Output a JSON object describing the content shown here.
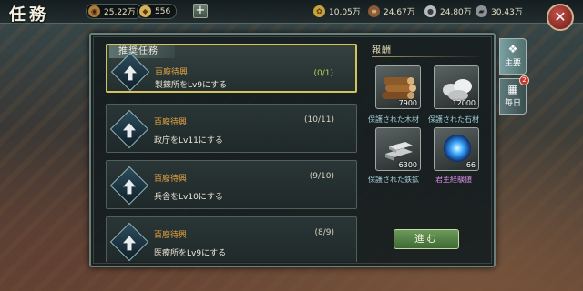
{
  "header": {
    "title": "任務",
    "resources_left": [
      {
        "icon": "copper-coin-icon",
        "value": "25.22万"
      },
      {
        "icon": "gold-ingot-icon",
        "value": "556"
      }
    ],
    "resources_right": [
      {
        "icon": "grain-icon",
        "value": "10.05万"
      },
      {
        "icon": "wood-icon",
        "value": "24.67万"
      },
      {
        "icon": "stone-icon",
        "value": "24.80万"
      },
      {
        "icon": "iron-icon",
        "value": "30.43万"
      }
    ]
  },
  "recommend_label": "推奨任務",
  "tasks": [
    {
      "name": "百廢待興",
      "desc": "製錬所をLv9にする",
      "progress": "(0/1)",
      "selected": true
    },
    {
      "name": "百廢待興",
      "desc": "政庁をLv11にする",
      "progress": "(10/11)",
      "selected": false
    },
    {
      "name": "百廢待興",
      "desc": "兵舎をLv10にする",
      "progress": "(9/10)",
      "selected": false
    },
    {
      "name": "百廢待興",
      "desc": "医療所をLv9にする",
      "progress": "(8/9)",
      "selected": false
    }
  ],
  "rewards": {
    "title": "報酬",
    "items": [
      {
        "icon": "wood-logs-icon",
        "count": "7900",
        "label": "保護された木材"
      },
      {
        "icon": "stone-icon",
        "count": "12000",
        "label": "保護された石材"
      },
      {
        "icon": "iron-ingot-icon",
        "count": "6300",
        "label": "保護された鉄鉱"
      },
      {
        "icon": "experience-orb-icon",
        "count": "66",
        "label": "君主経験値"
      }
    ],
    "go_button": "進む"
  },
  "side_tabs": [
    {
      "label": "主要",
      "active": true
    },
    {
      "label": "毎日",
      "active": false,
      "badge": "2"
    }
  ],
  "colors": {
    "accent_gold": "#d2c35c",
    "task_name": "#e4a440",
    "progress_active": "#a9d65a",
    "go_button": "#4f7f43"
  }
}
